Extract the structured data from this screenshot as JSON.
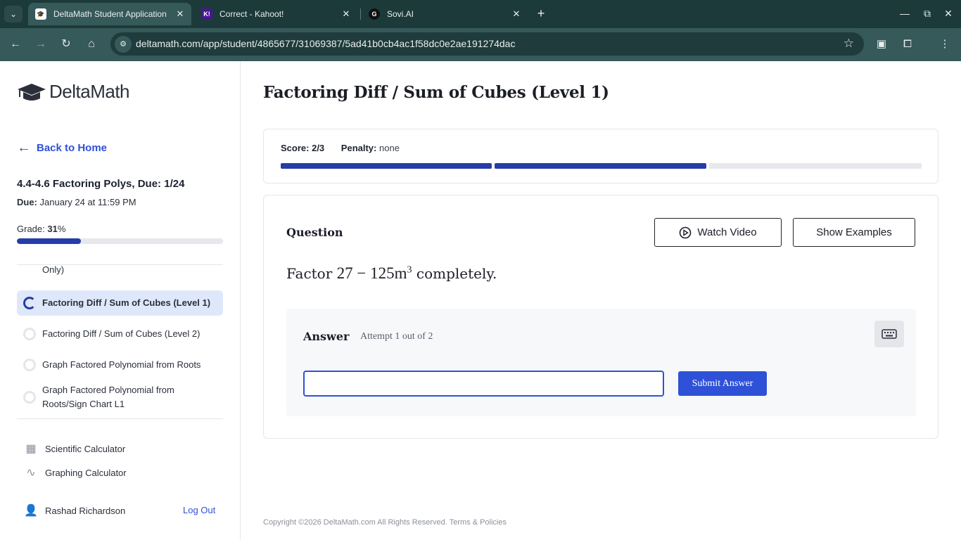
{
  "browser": {
    "tabs": [
      {
        "title": "DeltaMath Student Application",
        "favicon": "deltamath-favicon",
        "active": true
      },
      {
        "title": "Correct - Kahoot!",
        "favicon": "K!",
        "active": false
      },
      {
        "title": "Sovi.AI",
        "favicon": "sovi-favicon",
        "active": false
      }
    ],
    "close_glyph": "✕",
    "new_tab_glyph": "+",
    "url": "deltamath.com/app/student/4865677/31069387/5ad41b0cb4ac1f58dc0e2ae191274dac"
  },
  "sidebar": {
    "logo_text": "DeltaMath",
    "back_label": "Back to Home",
    "assignment_title": "4.4-4.6 Factoring Polys, Due: 1/24",
    "due_label": "Due:",
    "due_value": "January 24 at 11:59 PM",
    "grade_label": "Grade:",
    "grade_value": "31",
    "grade_suffix": "%",
    "grade_fraction": 0.31,
    "skills": [
      {
        "label": "Only)",
        "state": "partial-hidden"
      },
      {
        "label": "Factoring Diff / Sum of Cubes (Level 1)",
        "state": "active"
      },
      {
        "label": "Factoring Diff / Sum of Cubes (Level 2)",
        "state": "empty"
      },
      {
        "label": "Graph Factored Polynomial from Roots",
        "state": "empty"
      },
      {
        "label": "Graph Factored Polynomial from Roots/Sign Chart L1",
        "state": "empty"
      }
    ],
    "tools": [
      {
        "label": "Scientific Calculator",
        "icon": "calculator-icon"
      },
      {
        "label": "Graphing Calculator",
        "icon": "graph-icon"
      }
    ],
    "user_name": "Rashad Richardson",
    "logout_label": "Log Out"
  },
  "main": {
    "title": "Factoring Diff / Sum of Cubes (Level 1)",
    "score_label": "Score:",
    "score_value": "2/3",
    "penalty_label": "Penalty:",
    "penalty_value": "none",
    "progress_segments": [
      {
        "filled": true
      },
      {
        "filled": true
      },
      {
        "filled": false
      }
    ],
    "question_label": "Question",
    "watch_video_label": "Watch Video",
    "show_examples_label": "Show Examples",
    "question_prefix": "Factor",
    "question_math": "27 − 125m",
    "question_exponent": "3",
    "question_suffix": "completely.",
    "answer_label": "Answer",
    "attempt_text": "Attempt 1 out of 2",
    "answer_value": "",
    "submit_label": "Submit Answer"
  },
  "footer": {
    "copyright": "Copyright ©2026 DeltaMath.com All Rights Reserved. Terms & Policies"
  },
  "colors": {
    "accent": "#2f51d8",
    "progress": "#263da8",
    "chrome": "#1d3a3a"
  }
}
